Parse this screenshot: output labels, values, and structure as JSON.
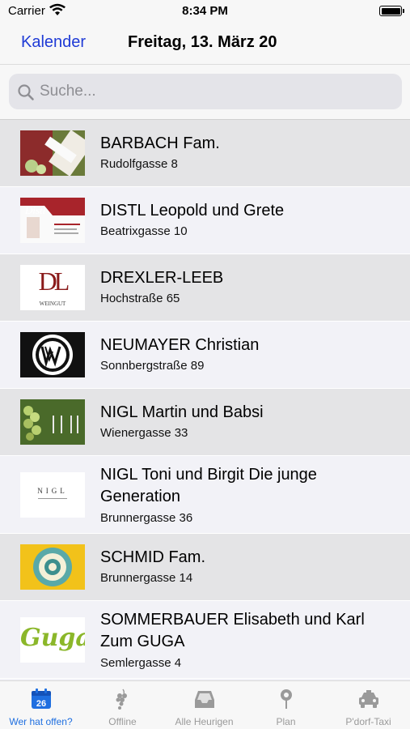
{
  "status": {
    "carrier": "Carrier",
    "time": "8:34 PM"
  },
  "nav": {
    "back_label": "Kalender",
    "title": "Freitag, 13. März 20"
  },
  "search": {
    "placeholder": "Suche..."
  },
  "list": [
    {
      "name": "BARBACH Fam.",
      "address": "Rudolfgasse 8",
      "logo": "barbach-logo"
    },
    {
      "name": "DISTL Leopold und Grete",
      "address": "Beatrixgasse 10",
      "logo": "distl-logo"
    },
    {
      "name": "DREXLER-LEEB",
      "address": "Hochstraße 65",
      "logo": "drexler-leeb-logo",
      "logo_text": "DL",
      "logo_sub": "WEINGUT"
    },
    {
      "name": "NEUMAYER Christian",
      "address": "Sonnbergstraße 89",
      "logo": "neumayer-logo"
    },
    {
      "name": "NIGL Martin und Babsi",
      "address": "Wienergasse 33",
      "logo": "nigl-martin-logo"
    },
    {
      "name": "NIGL Toni und Birgit Die junge Generation",
      "address": "Brunnergasse 36",
      "logo": "nigl-toni-logo",
      "logo_text": "NIGL"
    },
    {
      "name": "SCHMID Fam.",
      "address": "Brunnergasse 14",
      "logo": "schmid-logo"
    },
    {
      "name": "SOMMERBAUER Elisabeth und Karl Zum GUGA",
      "address": "Semlergasse 4",
      "logo": "guga-logo",
      "logo_text": "Guga"
    }
  ],
  "tabs": [
    {
      "label": "Wer hat offen?",
      "icon": "calendar-icon",
      "badge": "26",
      "active": true
    },
    {
      "label": "Offline",
      "icon": "grapes-icon",
      "active": false
    },
    {
      "label": "Alle Heurigen",
      "icon": "inbox-icon",
      "active": false
    },
    {
      "label": "Plan",
      "icon": "map-pin-icon",
      "active": false
    },
    {
      "label": "P'dorf-Taxi",
      "icon": "taxi-icon",
      "active": false
    }
  ],
  "colors": {
    "accent": "#1f3bd6",
    "tab_active": "#1f6fe0",
    "row_alt": "#e4e4e6",
    "row_plain": "#f2f2f7"
  }
}
